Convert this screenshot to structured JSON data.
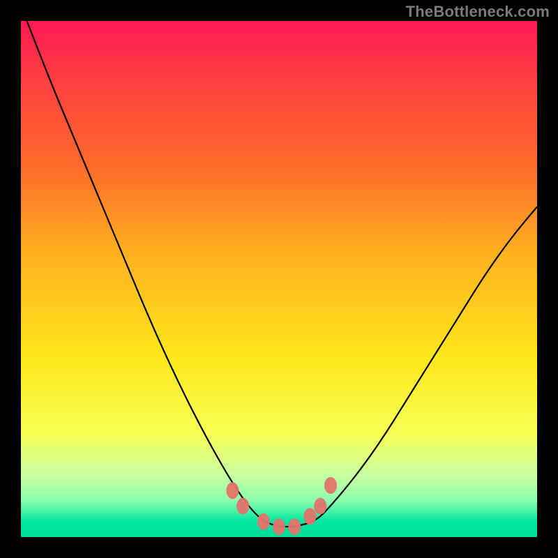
{
  "watermark": "TheBottleneck.com",
  "colors": {
    "gradient_top": "#ff1a54",
    "gradient_mid": "#ffe71a",
    "gradient_bottom": "#00dd98",
    "curve": "#000000",
    "marker": "#e3736c",
    "frame": "#000000"
  },
  "chart_data": {
    "type": "line",
    "title": "",
    "xlabel": "",
    "ylabel": "",
    "xlim": [
      0,
      100
    ],
    "ylim": [
      0,
      100
    ],
    "grid": false,
    "legend": false,
    "note": "No numeric axes or tick labels are shown; x/y expressed as percent of plot width/height with origin at bottom-left. Values estimated from pixel positions.",
    "series": [
      {
        "name": "curve",
        "x": [
          0,
          5,
          10,
          15,
          20,
          25,
          30,
          35,
          40,
          44,
          47,
          50,
          53,
          57,
          60,
          65,
          70,
          75,
          80,
          85,
          90,
          95,
          100
        ],
        "y": [
          103,
          90,
          78,
          66,
          54,
          42,
          31,
          21,
          12,
          6,
          3,
          2,
          2,
          3,
          6,
          12,
          19,
          27,
          35,
          43,
          51,
          58,
          64
        ]
      }
    ],
    "markers": {
      "name": "highlight-points",
      "x": [
        41,
        43,
        47,
        50,
        53,
        56,
        58,
        60
      ],
      "y": [
        9,
        6,
        3,
        2,
        2,
        4,
        6,
        10
      ]
    }
  }
}
